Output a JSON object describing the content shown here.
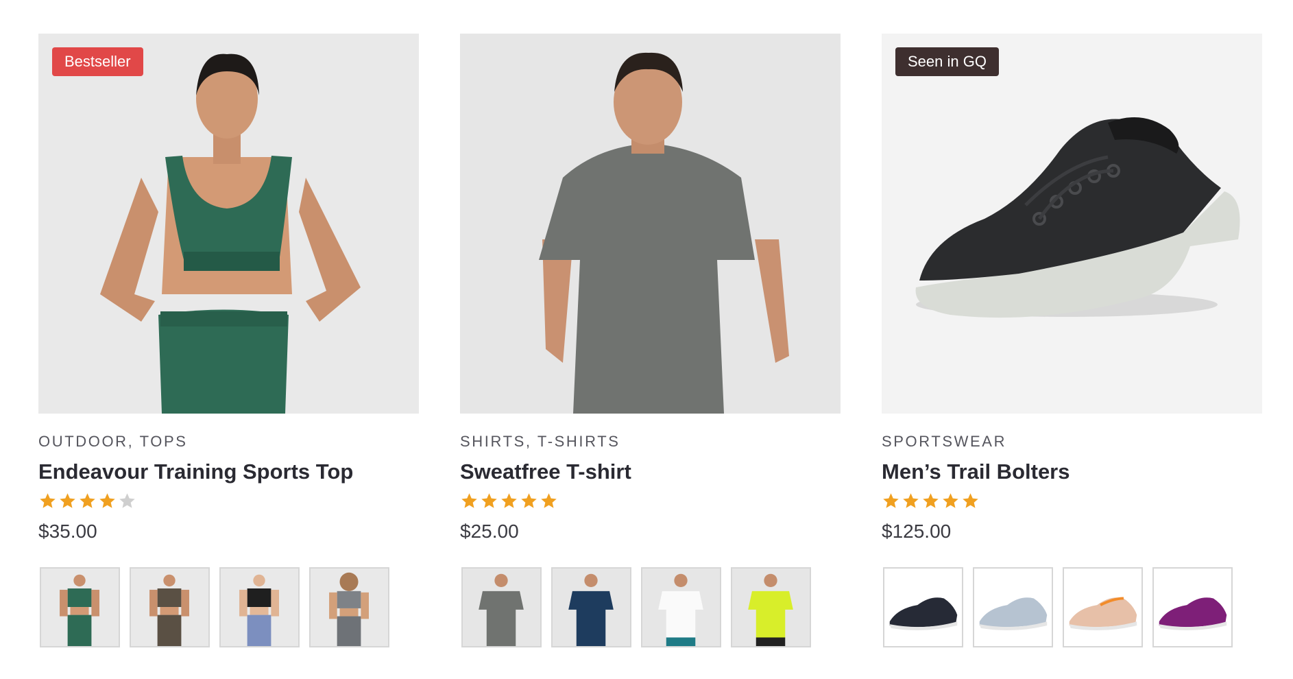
{
  "products": [
    {
      "badge": "Bestseller",
      "badge_color": "#e14848",
      "categories": "OUTDOOR, TOPS",
      "title": "Endeavour Training Sports Top",
      "rating": 4,
      "rating_max": 5,
      "price": "$35.00",
      "thumbnail_variants": [
        "green",
        "brown",
        "black-blue",
        "grey"
      ]
    },
    {
      "badge": "",
      "categories": "SHIRTS, T-SHIRTS",
      "title": "Sweatfree T-shirt",
      "rating": 5,
      "rating_max": 5,
      "price": "$25.00",
      "thumbnail_variants": [
        "grey",
        "navy",
        "white",
        "lime"
      ]
    },
    {
      "badge": "Seen in GQ",
      "badge_color": "#3e2f2f",
      "categories": "SPORTSWEAR",
      "title": "Men’s Trail Bolters",
      "rating": 5,
      "rating_max": 5,
      "price": "$125.00",
      "thumbnail_variants": [
        "navy",
        "light-blue",
        "peach",
        "purple"
      ]
    }
  ],
  "colors": {
    "star_filled": "#f0a020",
    "star_empty": "#cfcfcf",
    "image_bg": "#ebebeb"
  }
}
